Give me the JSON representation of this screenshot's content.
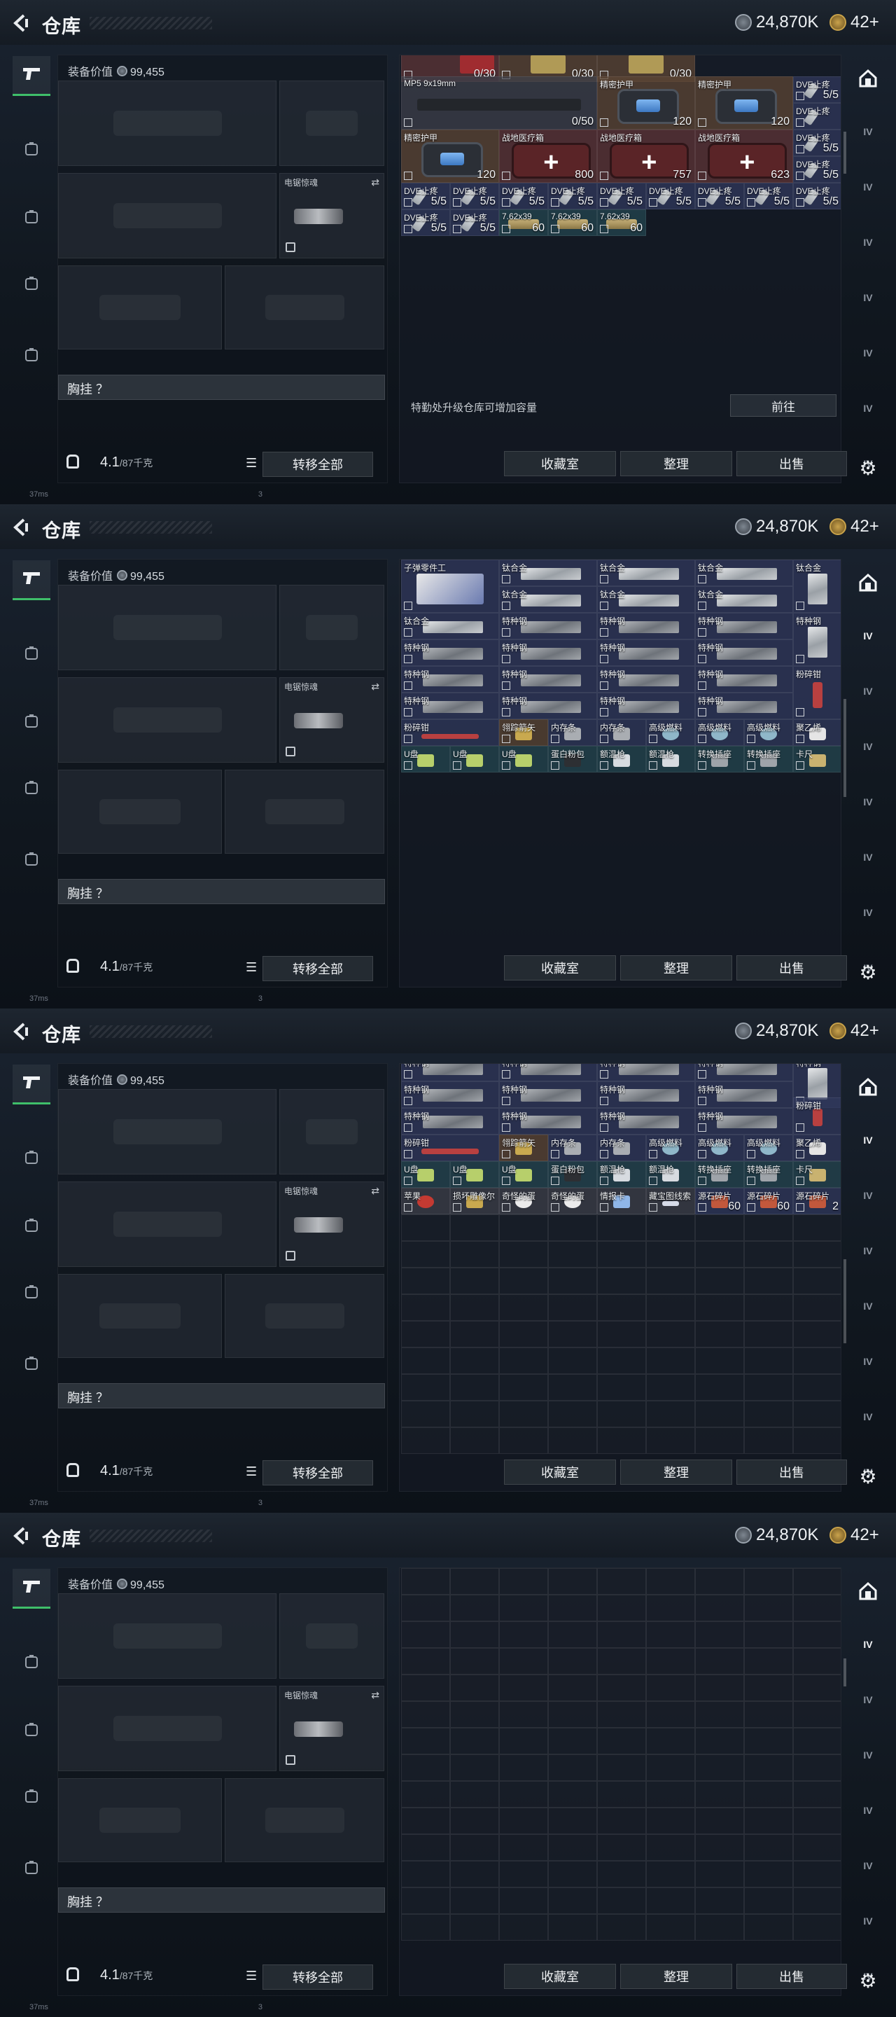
{
  "header": {
    "title": "仓库",
    "currency_silver": "24,870K",
    "currency_gold": "42+"
  },
  "equipment": {
    "value_label": "装备价值",
    "value": "99,455",
    "saw_slot_label": "电锯惊魂",
    "chest_label": "胸挂 ？",
    "weight": "4.1",
    "weight_cap": "/87千克",
    "transfer_all": "转移全部"
  },
  "actions": {
    "collection": "收藏室",
    "sort": "整理",
    "sell": "出售"
  },
  "upgrade": {
    "tip": "特勤处升级仓库可增加容量",
    "goto": "前往"
  },
  "status": {
    "ping": "37ms",
    "page_no": "3"
  },
  "right_nav": {
    "labels": [
      "IV",
      "IV",
      "IV",
      "IV",
      "IV",
      "IV",
      "IV",
      "IV"
    ]
  },
  "panel1_items": [
    {
      "name": "",
      "count": "0/30"
    },
    {
      "name": "",
      "count": "0/30"
    },
    {
      "name": "",
      "count": "0/30"
    },
    {
      "name": "MP5\n9x19mm",
      "count": "0/50"
    },
    {
      "name": "精密护甲",
      "count": "120"
    },
    {
      "name": "精密护甲",
      "count": "120"
    },
    {
      "name": "DVE止疼",
      "count": "5/5"
    },
    {
      "name": "DVE止疼",
      "count": "5/5"
    },
    {
      "name": "精密护甲",
      "count": "120"
    },
    {
      "name": "战地医疗箱",
      "count": "800"
    },
    {
      "name": "战地医疗箱",
      "count": "757"
    },
    {
      "name": "战地医疗箱",
      "count": "623"
    },
    {
      "name": "DVE止疼",
      "count": "5/5"
    },
    {
      "name": "DVE止疼",
      "count": "5/5"
    },
    {
      "name": "DVE止疼",
      "count": "5/5"
    },
    {
      "name": "DVE止疼",
      "count": "5/5"
    },
    {
      "name": "DVE止疼",
      "count": "5/5"
    },
    {
      "name": "DVE止疼",
      "count": "5/5"
    },
    {
      "name": "DVE止疼",
      "count": "5/5"
    },
    {
      "name": "DVE止疼",
      "count": "5/5"
    },
    {
      "name": "DVE止疼",
      "count": "5/5"
    },
    {
      "name": "DVE止疼",
      "count": "5/5"
    },
    {
      "name": "DVE止疼",
      "count": "5/5"
    },
    {
      "name": "7.62x39",
      "count": "60"
    },
    {
      "name": "7.62x39",
      "count": "60"
    },
    {
      "name": "7.62x39",
      "count": "60"
    }
  ],
  "panel2_items": {
    "case": "子弹零件工",
    "titanium": "钛合金",
    "special_steel": "特种钢",
    "pliers": "粉碎钳",
    "arrow": "翎踪箭矢",
    "memory": "内存条",
    "fuel": "高级燃料",
    "tape": "聚乙烯",
    "usb": "U盘",
    "powder": "蛋白粉包",
    "gun": "额温枪",
    "adapter": "转换插座",
    "ruler": "卡尺",
    "apple": "苹果",
    "horn": "损坏雕像尔",
    "egg": "奇怪的蛋",
    "card": "情报卡",
    "map": "藏宝图线索",
    "crystal": "源石碎片",
    "crystal_count1": "60",
    "crystal_count2": "60",
    "crystal_count3": "2"
  },
  "colors": {
    "accent_green": "#3fbf6a",
    "bg": "#111820"
  }
}
